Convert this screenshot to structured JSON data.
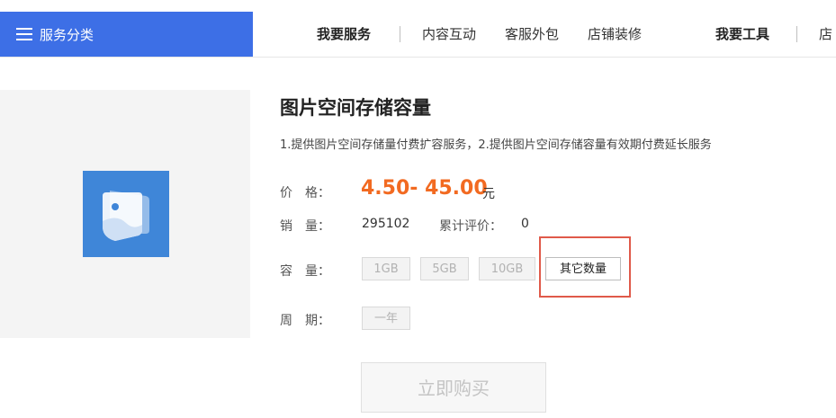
{
  "topbar": {
    "category_label": "服务分类",
    "nav": {
      "group1": "我要服务",
      "items": [
        "内容互动",
        "客服外包",
        "店铺装修"
      ],
      "group2": "我要工具",
      "cutoff": "店"
    }
  },
  "product": {
    "title": "图片空间存储容量",
    "description": "1.提供图片空间存储量付费扩容服务，2.提供图片空间存储容量有效期付费延长服务",
    "price": {
      "label": "价　格：",
      "value": "4.50- 45.00",
      "unit": "元"
    },
    "sales": {
      "label": "销　量：",
      "value": "295102",
      "reviews_label": "累计评价：",
      "reviews_value": "0"
    },
    "capacity": {
      "label": "容　量：",
      "options": [
        "1GB",
        "5GB",
        "10GB",
        "其它数量"
      ],
      "selected": "其它数量"
    },
    "period": {
      "label": "周　期：",
      "options": [
        "一年"
      ]
    },
    "buy_label": "立即购买"
  },
  "colors": {
    "brand_blue": "#3d6fe6",
    "price_orange": "#f26a21",
    "highlight_red": "#e05a4a",
    "app_icon_blue": "#3f86d8"
  }
}
